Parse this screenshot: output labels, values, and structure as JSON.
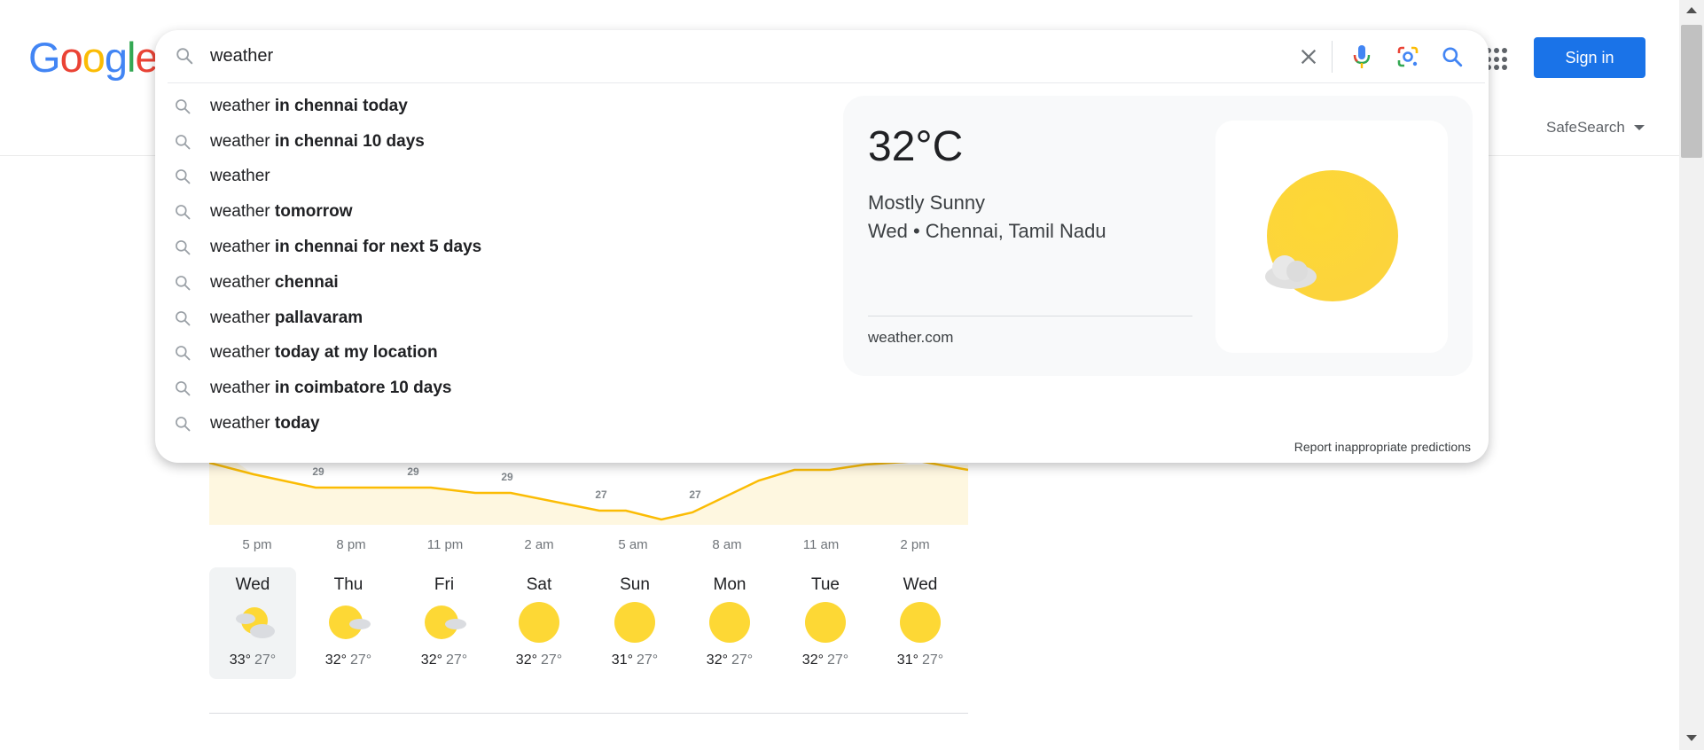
{
  "logo": {
    "text": "Google"
  },
  "header": {
    "signin_label": "Sign in",
    "safesearch_label": "SafeSearch"
  },
  "search": {
    "value": "weather",
    "placeholder": ""
  },
  "suggestions": [
    {
      "prefix": "weather",
      "bold": " in chennai today"
    },
    {
      "prefix": "weather",
      "bold": " in chennai 10 days"
    },
    {
      "prefix": "weather",
      "bold": ""
    },
    {
      "prefix": "weather",
      "bold": " tomorrow"
    },
    {
      "prefix": "weather",
      "bold": " in chennai for next 5 days"
    },
    {
      "prefix": "weather",
      "bold": " chennai"
    },
    {
      "prefix": "weather",
      "bold": " pallavaram"
    },
    {
      "prefix": "weather",
      "bold": " today at my location"
    },
    {
      "prefix": "weather",
      "bold": " in coimbatore 10 days"
    },
    {
      "prefix": "weather",
      "bold": " today"
    }
  ],
  "weather_card": {
    "temp": "32°C",
    "condition": "Mostly Sunny",
    "location": "Wed • Chennai, Tamil Nadu",
    "source": "weather.com"
  },
  "report_label": "Report inappropriate predictions",
  "chart_labels": [
    "29",
    "29",
    "29",
    "27",
    "27"
  ],
  "times": [
    "5 pm",
    "8 pm",
    "11 pm",
    "2 am",
    "5 am",
    "8 am",
    "11 am",
    "2 pm"
  ],
  "days": [
    {
      "name": "Wed",
      "hi": "33°",
      "lo": "27°",
      "icon": "partly-cloudy-icon"
    },
    {
      "name": "Thu",
      "hi": "32°",
      "lo": "27°",
      "icon": "mostly-sunny-icon"
    },
    {
      "name": "Fri",
      "hi": "32°",
      "lo": "27°",
      "icon": "mostly-sunny-icon"
    },
    {
      "name": "Sat",
      "hi": "32°",
      "lo": "27°",
      "icon": "sunny-icon"
    },
    {
      "name": "Sun",
      "hi": "31°",
      "lo": "27°",
      "icon": "sunny-icon"
    },
    {
      "name": "Mon",
      "hi": "32°",
      "lo": "27°",
      "icon": "sunny-icon"
    },
    {
      "name": "Tue",
      "hi": "32°",
      "lo": "27°",
      "icon": "sunny-icon"
    },
    {
      "name": "Wed",
      "hi": "31°",
      "lo": "27°",
      "icon": "sunny-icon"
    }
  ],
  "colors": {
    "accent": "#1a73e8",
    "sun": "#fdd835",
    "chart_fill": "#fef7e0",
    "chart_line": "#fbbc04"
  }
}
